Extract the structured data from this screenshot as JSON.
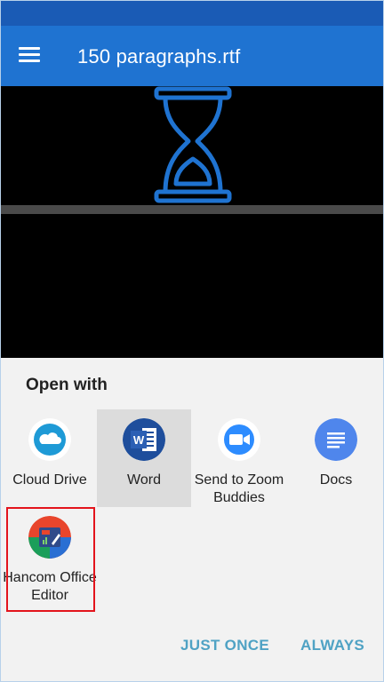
{
  "app_bar": {
    "title": "150 paragraphs.rtf"
  },
  "sheet": {
    "title": "Open with",
    "apps": [
      {
        "label": "Cloud Drive",
        "icon": "cloud-drive-icon"
      },
      {
        "label": "Word",
        "icon": "word-icon"
      },
      {
        "label": "Send to Zoom Buddies",
        "icon": "zoom-icon"
      },
      {
        "label": "Docs",
        "icon": "docs-icon"
      },
      {
        "label": "Hancom Office Editor",
        "icon": "hancom-office-icon"
      }
    ],
    "selected_app": "Word",
    "just_once_label": "JUST ONCE",
    "always_label": "ALWAYS"
  },
  "colors": {
    "status_bar": "#1a5bb5",
    "app_bar": "#1f73d1",
    "hourglass": "#1f73d1",
    "action_text": "#4fa2c4",
    "highlight": "#e3141c"
  }
}
